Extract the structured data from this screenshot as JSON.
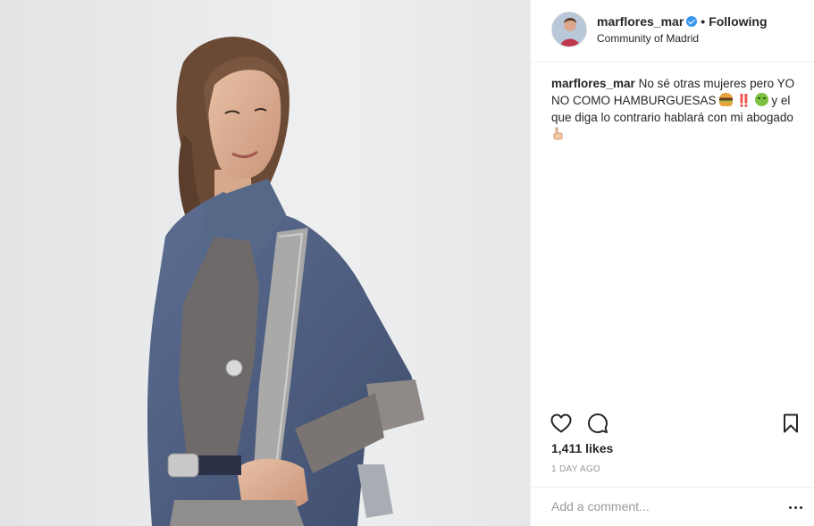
{
  "post": {
    "username": "marflores_mar",
    "verified": true,
    "separator": "•",
    "follow_status": "Following",
    "location": "Community of Madrid"
  },
  "caption": {
    "username": "marflores_mar",
    "part1": "No sé otras mujeres pero YO NO COMO HAMBURGUESAS",
    "part2": "‼️",
    "part3": "y el que diga lo contrario hablará con mi abogado",
    "emojis": [
      "burger-emoji",
      "sick-face-emoji",
      "pointing-hand-emoji"
    ]
  },
  "stats": {
    "likes": "1,411 likes",
    "time": "1 DAY AGO"
  },
  "comment": {
    "placeholder": "Add a comment..."
  },
  "icons": {
    "like": "heart-outline-icon",
    "comment": "comment-bubble-icon",
    "save": "bookmark-icon",
    "more": "more-options-icon"
  },
  "colors": {
    "verified": "#3897f0",
    "text": "#262626",
    "muted": "#999999",
    "border": "#efefef",
    "photo_background": "#e9eaec"
  }
}
